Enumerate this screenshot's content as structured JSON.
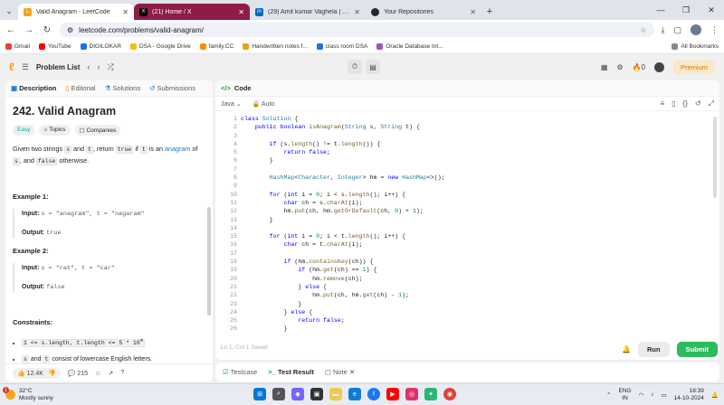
{
  "browser": {
    "tabs": [
      {
        "title": "Valid Anagram - LeetCode",
        "active": true,
        "fav_color": "#f89f1b",
        "icon": "leetcode-icon"
      },
      {
        "title": "(21) Home / X",
        "active": false,
        "fav_color": "#000000",
        "icon": "x-icon"
      },
      {
        "title": "(29) Amit kumar Vaghela | Linkedin",
        "active": false,
        "fav_color": "#0a66c2",
        "icon": "linkedin-icon"
      },
      {
        "title": "Your Repositories",
        "active": false,
        "fav_color": "#24292f",
        "icon": "github-icon"
      }
    ],
    "url": "leetcode.com/problems/valid-anagram/",
    "bookmarks": [
      {
        "label": "Gmail",
        "color": "#ea4335"
      },
      {
        "label": "YouTube",
        "color": "#ff0000"
      },
      {
        "label": "DIGILOKAR",
        "color": "#1a73e8"
      },
      {
        "label": "DSA - Google Drive",
        "color": "#fbbc04"
      },
      {
        "label": "family.CC",
        "color": "#ff8c00"
      },
      {
        "label": "Handwritten notes f...",
        "color": "#e8a317"
      },
      {
        "label": "class room DSA",
        "color": "#1a73e8"
      },
      {
        "label": "Oracle Database Int...",
        "color": "#9b59b6"
      }
    ],
    "all_bookmarks": "All Bookmarks"
  },
  "lc": {
    "problem_list": "Problem List",
    "streak": "0",
    "premium": "Premium"
  },
  "left": {
    "tabs": [
      "Description",
      "Editorial",
      "Solutions",
      "Submissions"
    ],
    "title": "242. Valid Anagram",
    "tags": [
      "Easy",
      "Topics",
      "Companies"
    ],
    "desc": {
      "p1": "Given two strings ",
      "s": "s",
      "and": " and ",
      "t": "t",
      "p2": ", return ",
      "true": "true",
      "if": " if ",
      "is_an": " is an ",
      "anagram": "anagram",
      "of": " of",
      "p3": ", and ",
      "false": "false",
      "p4": " otherwise."
    },
    "ex1": {
      "title": "Example 1:",
      "input_label": "Input:",
      "input": "s = \"anagram\", t = \"nagaram\"",
      "output_label": "Output:",
      "output": "true"
    },
    "ex2": {
      "title": "Example 2:",
      "input_label": "Input:",
      "input": "s = \"rat\", t = \"car\"",
      "output_label": "Output:",
      "output": "false"
    },
    "constraints_title": "Constraints:",
    "c1": "1 <= s.length, t.length <= 5 * 10",
    "c1_sup": "4",
    "c2_s": "s",
    "c2_and": " and ",
    "c2_t": "t",
    "c2_rest": " consist of lowercase English letters.",
    "likes": "12.4K",
    "comments": "215"
  },
  "right": {
    "header": "Code",
    "language": "Java",
    "auto": "Auto",
    "status": "Ln 1, Col 1   Saved",
    "run": "Run",
    "submit": "Submit",
    "bottom_tabs": [
      "Testcase",
      "Test Result",
      "Note"
    ]
  },
  "taskbar": {
    "temp": "32°C",
    "weather": "Mostly sunny",
    "badge": "1",
    "lang": "ENG",
    "region": "IN",
    "time": "18:39",
    "date": "14-10-2024"
  }
}
